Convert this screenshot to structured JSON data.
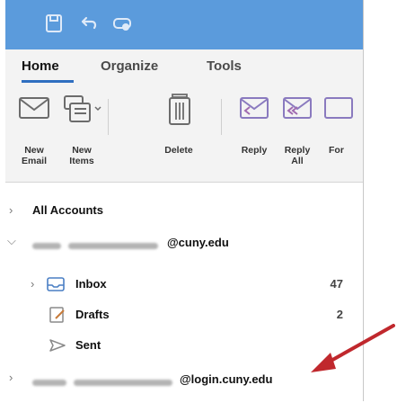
{
  "toolbar": {
    "tabs": [
      {
        "label": "Home",
        "active": true
      },
      {
        "label": "Organize",
        "active": false
      },
      {
        "label": "Tools",
        "active": false
      }
    ],
    "buttons": [
      {
        "label": "New\nEmail",
        "icon": "new-email-icon"
      },
      {
        "label": "New\nItems",
        "icon": "new-items-icon"
      },
      {
        "label": "Delete",
        "icon": "trash-icon"
      },
      {
        "label": "Reply",
        "icon": "reply-icon"
      },
      {
        "label": "Reply\nAll",
        "icon": "reply-all-icon"
      },
      {
        "label": "For",
        "icon": "forward-icon"
      }
    ]
  },
  "sidebar": {
    "all_accounts": "All Accounts",
    "account1": {
      "domain": "@cuny.edu",
      "expanded": true
    },
    "folders": [
      {
        "label": "Inbox",
        "count": "47",
        "icon": "inbox-icon"
      },
      {
        "label": "Drafts",
        "count": "2",
        "icon": "drafts-icon"
      },
      {
        "label": "Sent",
        "count": "",
        "icon": "sent-icon"
      }
    ],
    "account2": {
      "domain": "@login.cuny.edu",
      "expanded": false
    }
  },
  "colors": {
    "titlebar": "#5b9bdc",
    "tab_underline": "#2f6fc0",
    "annotation_arrow": "#c0282d"
  }
}
